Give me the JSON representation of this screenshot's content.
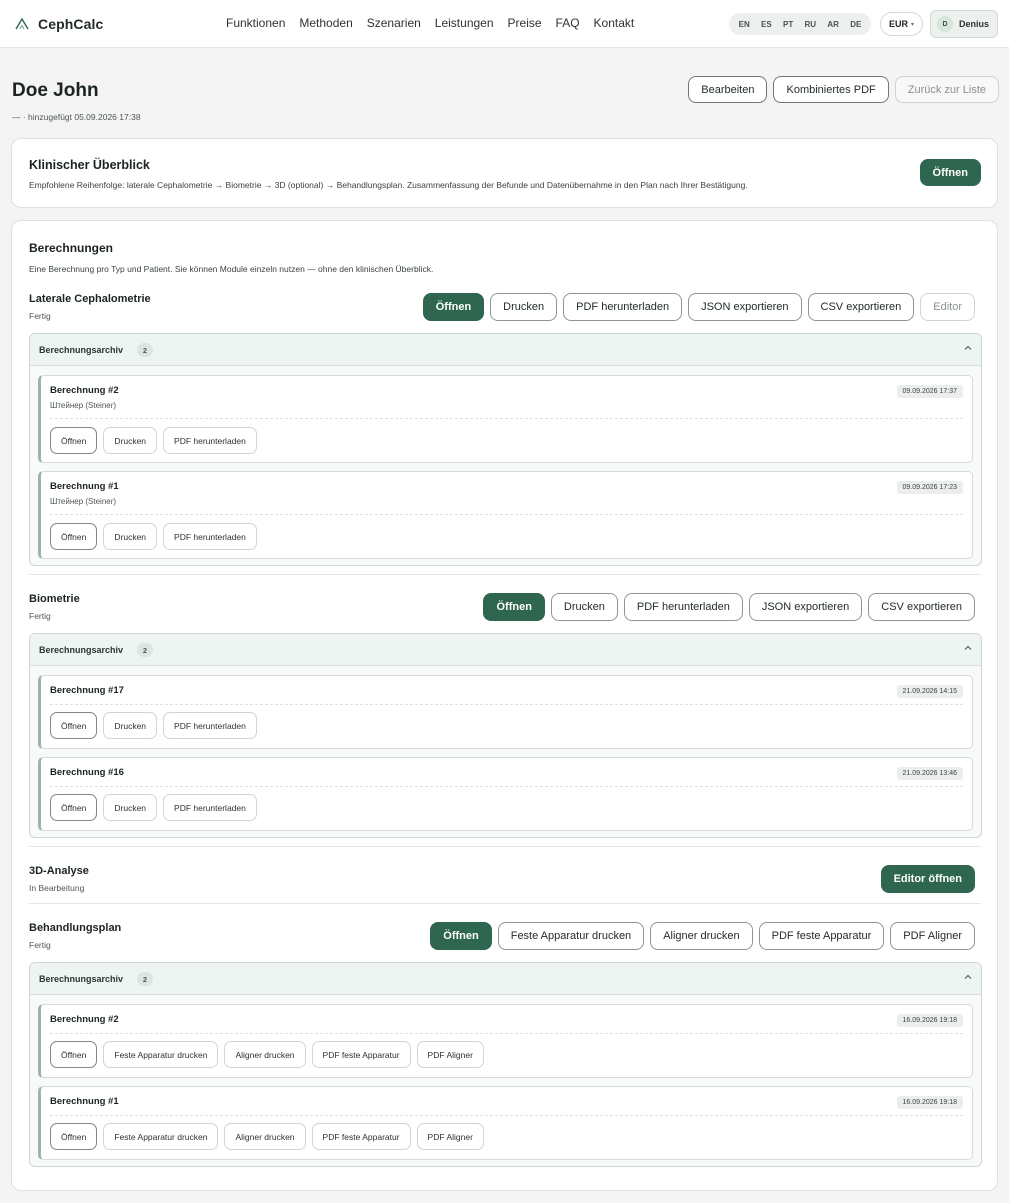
{
  "app": {
    "logo": "CephCalc"
  },
  "nav": [
    "Funktionen",
    "Methoden",
    "Szenarien",
    "Leistungen",
    "Preise",
    "FAQ",
    "Kontakt"
  ],
  "languages": [
    "EN",
    "ES",
    "PT",
    "RU",
    "AR",
    "DE"
  ],
  "currency": "EUR",
  "user": {
    "initial": "D",
    "name": "Denius"
  },
  "patient": {
    "name": "Doe John",
    "subtitle": "— · hinzugefügt 05.09.2026 17:38",
    "actions": {
      "edit": "Bearbeiten",
      "combined_pdf": "Kombiniertes PDF",
      "back": "Zurück zur Liste"
    }
  },
  "overview": {
    "title": "Klinischer Überblick",
    "description": "Empfohlene Reihenfolge: laterale Cephalometrie → Biometrie → 3D (optional) → Behandlungsplan. Zusammenfassung der Befunde und Datenübernahme in den Plan nach Ihrer Bestätigung.",
    "open": "Öffnen"
  },
  "calculations": {
    "title": "Berechnungen",
    "description": "Eine Berechnung pro Typ und Patient. Sie können Module einzeln nutzen — ohne den klinischen Überblick.",
    "modules": [
      {
        "title": "Laterale Cephalometrie",
        "status": "Fertig",
        "actions": [
          "Öffnen",
          "Drucken",
          "PDF herunterladen",
          "JSON exportieren",
          "CSV exportieren",
          "Editor"
        ],
        "archive": {
          "label": "Berechnungsarchiv",
          "count": "2",
          "entries": [
            {
              "name": "Berechnung #2",
              "method": "Штейнер (Steiner)",
              "date": "09.09.2026 17:37",
              "actions": [
                "Öffnen",
                "Drucken",
                "PDF herunterladen"
              ]
            },
            {
              "name": "Berechnung #1",
              "method": "Штейнер (Steiner)",
              "date": "09.09.2026 17:23",
              "actions": [
                "Öffnen",
                "Drucken",
                "PDF herunterladen"
              ]
            }
          ]
        }
      },
      {
        "title": "Biometrie",
        "status": "Fertig",
        "actions": [
          "Öffnen",
          "Drucken",
          "PDF herunterladen",
          "JSON exportieren",
          "CSV exportieren"
        ],
        "archive": {
          "label": "Berechnungsarchiv",
          "count": "2",
          "entries": [
            {
              "name": "Berechnung #17",
              "date": "21.09.2026 14:15",
              "actions": [
                "Öffnen",
                "Drucken",
                "PDF herunterladen"
              ]
            },
            {
              "name": "Berechnung #16",
              "date": "21.09.2026 13:46",
              "actions": [
                "Öffnen",
                "Drucken",
                "PDF herunterladen"
              ]
            }
          ]
        }
      },
      {
        "title": "3D-Analyse",
        "status": "In Bearbeitung",
        "actions": [
          "Editor öffnen"
        ]
      },
      {
        "title": "Behandlungsplan",
        "status": "Fertig",
        "actions": [
          "Öffnen",
          "Feste Apparatur drucken",
          "Aligner drucken",
          "PDF feste Apparatur",
          "PDF Aligner"
        ],
        "archive": {
          "label": "Berechnungsarchiv",
          "count": "2",
          "entries": [
            {
              "name": "Berechnung #2",
              "date": "16.09.2026 19:18",
              "actions": [
                "Öffnen",
                "Feste Apparatur drucken",
                "Aligner drucken",
                "PDF feste Apparatur",
                "PDF Aligner"
              ]
            },
            {
              "name": "Berechnung #1",
              "date": "16.09.2026 19:18",
              "actions": [
                "Öffnen",
                "Feste Apparatur drucken",
                "Aligner drucken",
                "PDF feste Apparatur",
                "PDF Aligner"
              ]
            }
          ]
        }
      }
    ]
  },
  "colors": {
    "accent": "#2f6650",
    "background": "#f3f4f3",
    "card": "#ffffff"
  }
}
